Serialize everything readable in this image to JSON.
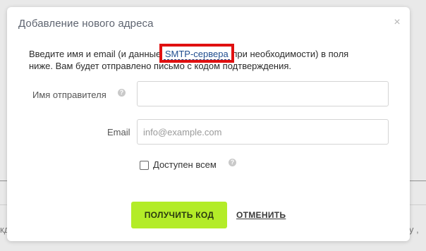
{
  "background": {
    "left_fragment": "кд",
    "right_fragment": "у ,"
  },
  "dialog": {
    "title": "Добавление нового адреса",
    "close_glyph": "×",
    "intro_before": "Введите имя и email (и данные ",
    "intro_link": "SMTP-сервера",
    "intro_after": " при необходимости) в поля ниже. Вам будет отправлено письмо с кодом подтверждения.",
    "sender_label": "Имя отправителя",
    "sender_value": "",
    "email_label": "Email",
    "email_placeholder": "info@example.com",
    "email_value": "",
    "public_label": "Доступен всем",
    "public_checked": false,
    "help_glyph": "?",
    "submit_label": "ПОЛУЧИТЬ КОД",
    "cancel_label": "ОТМЕНИТЬ"
  },
  "colors": {
    "primary_button": "#b3ec28",
    "link": "#1f4d8f",
    "highlight_box": "#e01010"
  },
  "icons": {
    "close": "close-icon",
    "help": "help-icon"
  }
}
